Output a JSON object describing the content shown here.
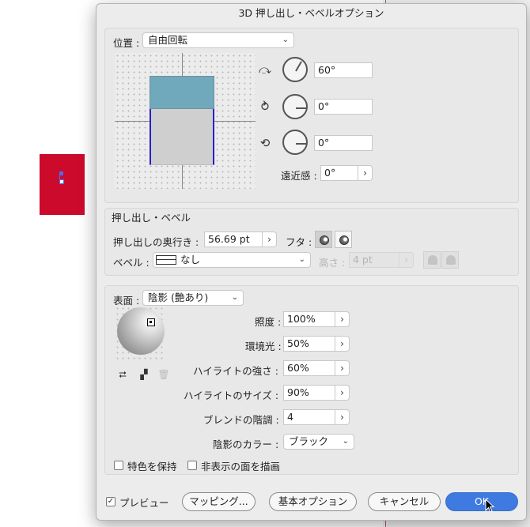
{
  "dialog": {
    "title": "3D 押し出し・ベベルオプション"
  },
  "position": {
    "label": "位置 :",
    "preset": "自由回転",
    "x_rotation": {
      "value": "60°",
      "angle": 60
    },
    "y_rotation": {
      "value": "0°",
      "angle": 0
    },
    "z_rotation": {
      "value": "0°",
      "angle": 0
    },
    "perspective_label": "遠近感 :",
    "perspective_value": "0°"
  },
  "extrude": {
    "section_label": "押し出し・ベベル",
    "depth_label": "押し出しの奥行き :",
    "depth_value": "56.69 pt",
    "cap_label": "フタ :",
    "bevel_label": "ベベル :",
    "bevel_value": "なし",
    "height_label": "高さ :",
    "height_value": "4 pt"
  },
  "surface": {
    "label": "表面 :",
    "preset": "陰影 (艶あり)",
    "light_intensity_label": "照度 :",
    "light_intensity": "100%",
    "ambient_label": "環境光 :",
    "ambient": "50%",
    "highlight_intensity_label": "ハイライトの強さ :",
    "highlight_intensity": "60%",
    "highlight_size_label": "ハイライトのサイズ :",
    "highlight_size": "90%",
    "blend_steps_label": "ブレンドの階調 :",
    "blend_steps": "4",
    "shade_color_label": "陰影のカラー :",
    "shade_color": "ブラック",
    "preserve_spot_label": "特色を保持",
    "draw_hidden_label": "非表示の面を描画"
  },
  "footer": {
    "preview_label": "プレビュー",
    "mapping_label": "マッピング...",
    "basic_label": "基本オプション",
    "cancel_label": "キャンセル",
    "ok_label": "OK"
  },
  "colors": {
    "accent": "#3f7ae0",
    "artboard_red": "#cc0a2c",
    "cube_top": "#71a9bc",
    "cube_front": "#cfcfcf",
    "extrude_edge": "#2a1ccf"
  },
  "icons": {
    "x_axis": "x-rotation-icon",
    "y_axis": "y-rotation-icon",
    "z_axis": "z-rotation-icon",
    "cap_on": "cap-on-icon",
    "cap_off": "cap-off-icon",
    "bevel_out": "bevel-out-icon",
    "bevel_in": "bevel-in-icon",
    "move_light_back": "move-light-back-icon",
    "new_light": "new-light-icon",
    "delete_light": "trash-icon"
  }
}
